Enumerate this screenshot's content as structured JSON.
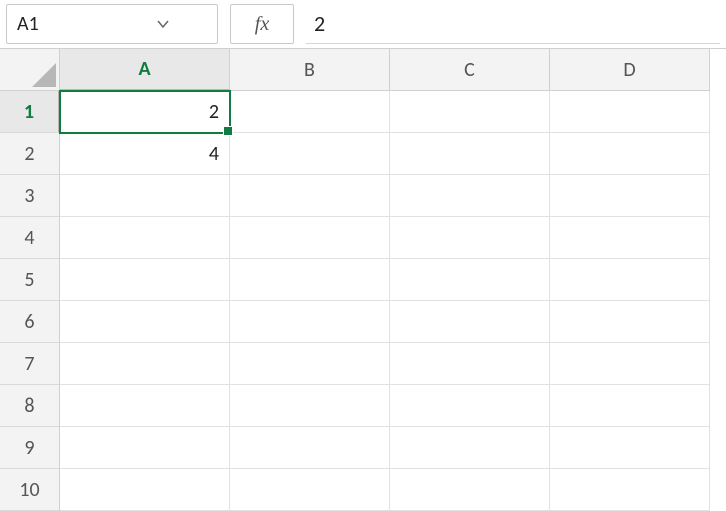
{
  "name_box": {
    "value": "A1"
  },
  "fx_label": "fx",
  "formula_input": {
    "value": "2"
  },
  "columns": [
    "A",
    "B",
    "C",
    "D"
  ],
  "rows": [
    "1",
    "2",
    "3",
    "4",
    "5",
    "6",
    "7",
    "8",
    "9",
    "10"
  ],
  "active_cell": "A1",
  "cells": {
    "A1": "2",
    "A2": "4"
  }
}
